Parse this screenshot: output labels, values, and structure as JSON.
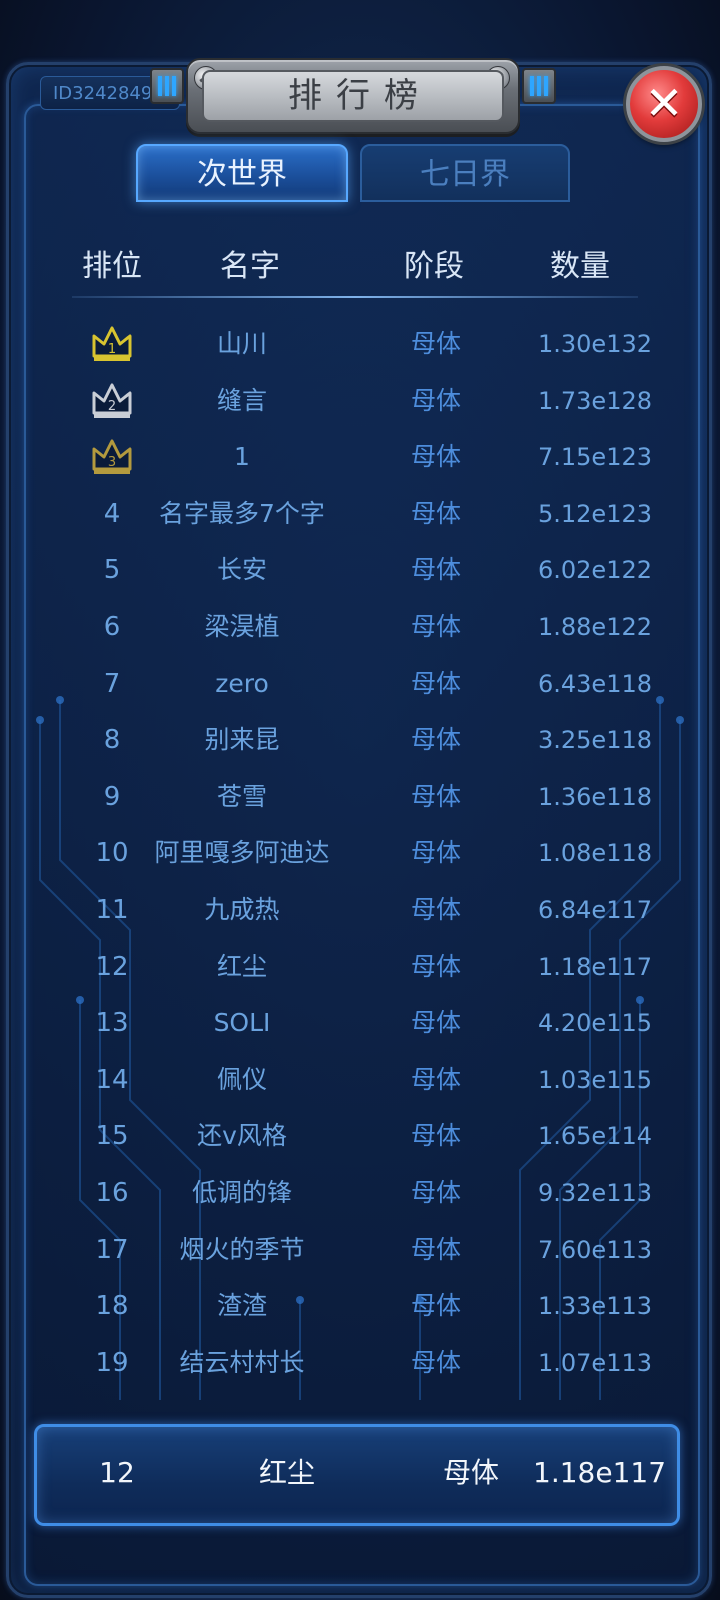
{
  "window": {
    "title": "排行榜",
    "player_id": "ID3242849"
  },
  "tabs": [
    {
      "label": "次世界",
      "active": true
    },
    {
      "label": "七日界",
      "active": false
    }
  ],
  "table": {
    "headers": {
      "rank": "排位",
      "name": "名字",
      "stage": "阶段",
      "amount": "数量"
    },
    "rows": [
      {
        "rank": "1",
        "name": "山川",
        "stage": "母体",
        "amount": "1.30e132",
        "medal": "gold"
      },
      {
        "rank": "2",
        "name": "缝言",
        "stage": "母体",
        "amount": "1.73e128",
        "medal": "silver"
      },
      {
        "rank": "3",
        "name": "1",
        "stage": "母体",
        "amount": "7.15e123",
        "medal": "bronze"
      },
      {
        "rank": "4",
        "name": "名字最多7个字",
        "stage": "母体",
        "amount": "5.12e123"
      },
      {
        "rank": "5",
        "name": "长安",
        "stage": "母体",
        "amount": "6.02e122"
      },
      {
        "rank": "6",
        "name": "梁淏植",
        "stage": "母体",
        "amount": "1.88e122"
      },
      {
        "rank": "7",
        "name": "zero",
        "stage": "母体",
        "amount": "6.43e118"
      },
      {
        "rank": "8",
        "name": "别来昆",
        "stage": "母体",
        "amount": "3.25e118"
      },
      {
        "rank": "9",
        "name": "苍雪",
        "stage": "母体",
        "amount": "1.36e118"
      },
      {
        "rank": "10",
        "name": "阿里嘎多阿迪达",
        "stage": "母体",
        "amount": "1.08e118"
      },
      {
        "rank": "11",
        "name": "九成热",
        "stage": "母体",
        "amount": "6.84e117"
      },
      {
        "rank": "12",
        "name": "红尘",
        "stage": "母体",
        "amount": "1.18e117"
      },
      {
        "rank": "13",
        "name": "SOLI",
        "stage": "母体",
        "amount": "4.20e115"
      },
      {
        "rank": "14",
        "name": "佩仪",
        "stage": "母体",
        "amount": "1.03e115"
      },
      {
        "rank": "15",
        "name": "还v风格",
        "stage": "母体",
        "amount": "1.65e114"
      },
      {
        "rank": "16",
        "name": "低调的锋",
        "stage": "母体",
        "amount": "9.32e113"
      },
      {
        "rank": "17",
        "name": "烟火的季节",
        "stage": "母体",
        "amount": "7.60e113"
      },
      {
        "rank": "18",
        "name": "渣渣",
        "stage": "母体",
        "amount": "1.33e113"
      },
      {
        "rank": "19",
        "name": "结云村村长",
        "stage": "母体",
        "amount": "1.07e113"
      }
    ]
  },
  "my_rank": {
    "rank": "12",
    "name": "红尘",
    "stage": "母体",
    "amount": "1.18e117"
  },
  "icons": {
    "close": "close-icon",
    "medal": "crown-icon"
  },
  "colors": {
    "gold": "#d8c430",
    "silver": "#c9ced6",
    "bronze": "#b39a3e",
    "accent": "#3f8de6",
    "row_text": "#6aa2de",
    "close_red": "#e23b3b"
  }
}
